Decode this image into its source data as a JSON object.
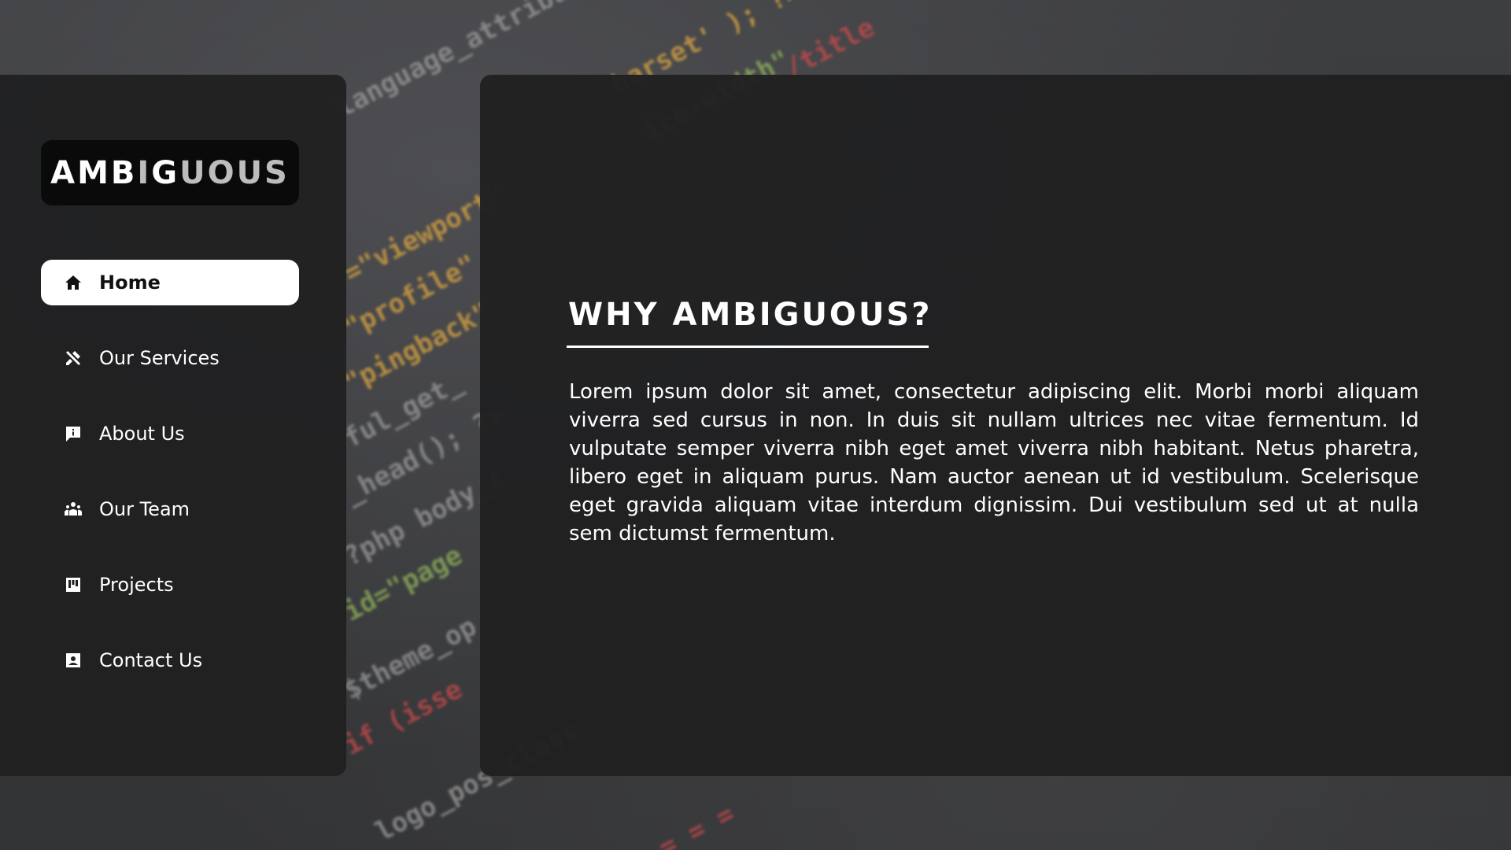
{
  "brand": {
    "name_part1": "AMB",
    "name_part2": "I",
    "name_part3": "G",
    "name_part4": "UOUS"
  },
  "nav": {
    "items": [
      {
        "label": "Home",
        "icon": "home-icon",
        "active": true
      },
      {
        "label": "Our Services",
        "icon": "tools-icon",
        "active": false
      },
      {
        "label": "About Us",
        "icon": "info-icon",
        "active": false
      },
      {
        "label": "Our Team",
        "icon": "team-icon",
        "active": false
      },
      {
        "label": "Projects",
        "icon": "projects-icon",
        "active": false
      },
      {
        "label": "Contact Us",
        "icon": "contact-icon",
        "active": false
      }
    ]
  },
  "main": {
    "heading": "WHY AMBIGUOUS?",
    "body": "Lorem ipsum dolor sit amet, consectetur adipiscing elit. Morbi morbi aliquam viverra sed cursus in non. In duis sit nullam ultrices nec vitae fermentum. Id vulputate semper viverra nibh eget amet viverra nibh habitant. Netus pharetra, libero eget in aliquam purus. Nam auctor aenean ut id vestibulum. Scelerisque eget gravida aliquam vitae interdum dignissim. Dui vestibulum sed ut at nulla sem dictumst fermentum."
  },
  "colors": {
    "panel": "#202021",
    "accent": "#ffffff",
    "logo_bg": "#0a0a0a"
  }
}
